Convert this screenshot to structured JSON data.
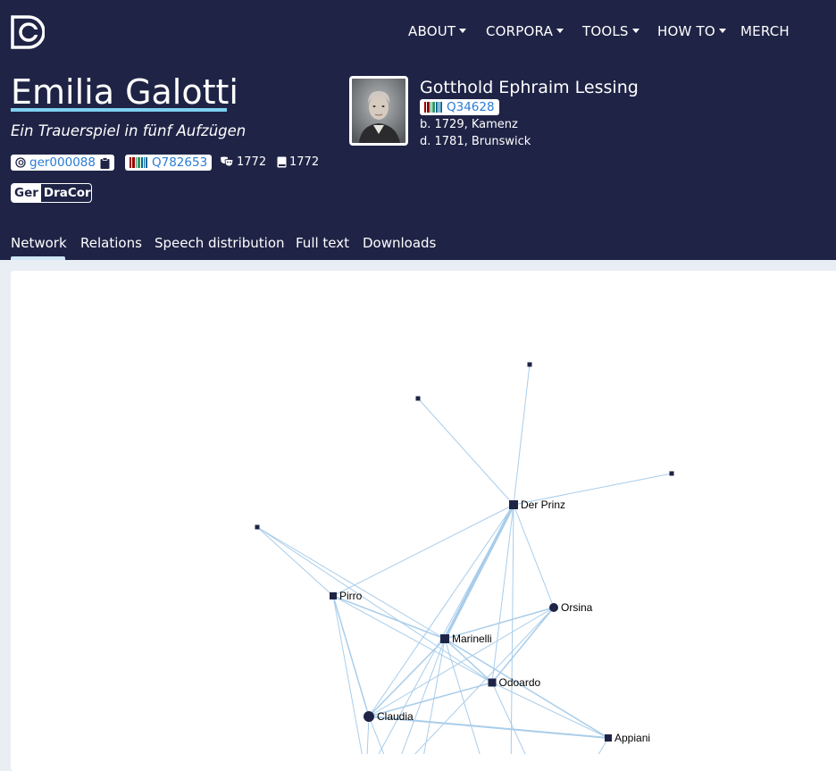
{
  "nav": {
    "about": "ABOUT",
    "corpora": "CORPORA",
    "tools": "TOOLS",
    "howto": "HOW TO",
    "merch": "MERCH"
  },
  "play": {
    "title": "Emilia Galotti",
    "subtitle": "Ein Trauerspiel in fünf Aufzügen",
    "id": "ger000088",
    "wikidata": "Q782653",
    "premiere_year": "1772",
    "print_year": "1772",
    "corpus_prefix": "Ger",
    "corpus_name": "DraCor"
  },
  "author": {
    "name": "Gotthold Ephraim Lessing",
    "wikidata": "Q34628",
    "born": "b. 1729, Kamenz",
    "died": "d. 1781, Brunswick"
  },
  "tabs": [
    "Network",
    "Relations",
    "Speech distribution",
    "Full text",
    "Downloads"
  ],
  "network": {
    "nodes": [
      {
        "label": "Der Prinz",
        "shape": "square"
      },
      {
        "label": "Pirro",
        "shape": "square"
      },
      {
        "label": "Orsina",
        "shape": "circle"
      },
      {
        "label": "Marinelli",
        "shape": "square"
      },
      {
        "label": "Odoardo",
        "shape": "square"
      },
      {
        "label": "Claudia",
        "shape": "circle"
      },
      {
        "label": "Appiani",
        "shape": "square"
      }
    ]
  },
  "colors": {
    "header_bg": "#1f2446",
    "page_bg": "#e9eef5",
    "link": "#2a7bd6",
    "accent": "#7fd0f0",
    "edge": "#a9cdea",
    "node": "#1f2446"
  }
}
